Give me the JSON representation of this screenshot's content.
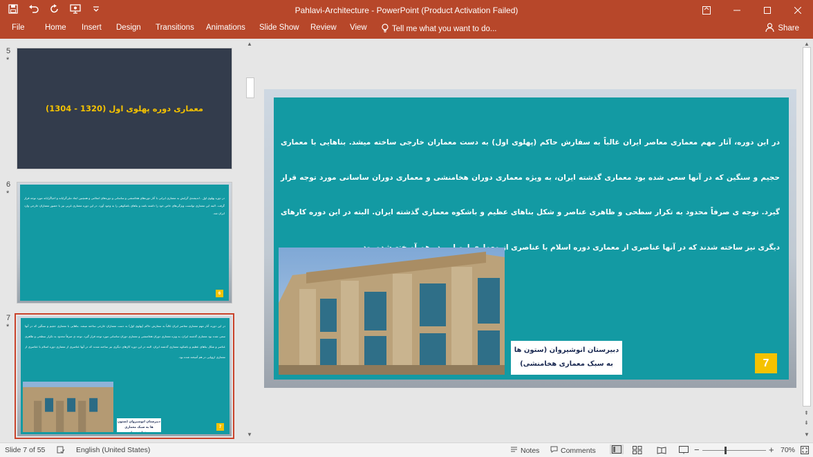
{
  "window": {
    "title": "Pahlavi-Architecture - PowerPoint (Product Activation Failed)",
    "controls": [
      "restore-ribbon",
      "minimize",
      "maximize",
      "close"
    ]
  },
  "quick_access": [
    "save-icon",
    "undo-icon",
    "redo-icon",
    "present-icon",
    "customize-icon"
  ],
  "ribbon": {
    "tabs": [
      "File",
      "Home",
      "Insert",
      "Design",
      "Transitions",
      "Animations",
      "Slide Show",
      "Review",
      "View"
    ],
    "tell_me": "Tell me what you want to do...",
    "share": "Share"
  },
  "thumbnails": [
    {
      "number": "5",
      "star": "*",
      "title": "معماری دوره پهلوی اول (1320 - 1304)"
    },
    {
      "number": "6",
      "star": "*",
      "text": "در دوره پهلوی اول ، انديشه‌ی گرايش به معماری ايرانی با آثار دوره‌های هخامنشی و ساسانی و دوره‌های اسلامی و همچنين ابعاد ملی‌گرايانه و احياگرايانه مورد توجه قرار گرفت. البته اين معماری توانست ويژگی‌های خاص خود را داشته باشد و بناهای باشكوهی را به وجود آورد. در اين دوره معماری غربی نيز با حضور معماران خارجی وارد ايران شد.",
      "badge": "6"
    },
    {
      "number": "7",
      "star": "*",
      "text": "در اين دوره، آثار مهم معماری معاصر ايران غالباً به سفارش حاكم (پهلوی اول) به دست معماران خارجی ساخته ميشد. بناهايی با معماری حجيم و سنگين كه در آنها سعی شده بود معماری گذشته ايران، به ويژه معماری دوران هخامنشی و معماری دوران ساسانی مورد توجه قرار گيرد. توجه ی صرفاً محدود به تكرار سطحی و ظاهری عناصر و شكل بناهای عظيم و باشكوه معماری گذشته ايران. البته در اين دوره كارهای ديگری نيز ساخته شدند كه در آنها عناصری از معماری دوره اسلام با عناصری از معماری اروپايی در هم آميخته شده بود.",
      "caption": "دبيرستان انوشيروان (ستون ها به سبک معماری هخامنشی)",
      "badge": "7"
    }
  ],
  "main_slide": {
    "text": "در این دوره، آثار مهم معماری معاصر ایران غالباً به سفارش حاکم (پهلوی اول) به دست معماران خارجی ساخته میشد. بناهایی با معماری حجیم و سنگین که در آنها سعی شده بود معماری گذشته ایران، به ویژه معماری دوران هخامنشی و معماری دوران ساسانی مورد توجه قرار گیرد. توجه ی صرفاً محدود به تکرار سطحی و ظاهری عناصر و شکل بناهای عظیم و باشکوه معماری گذشته ایران. البته در این دوره کارهای دیگری نیز ساخته شدند که در آنها عناصری از معماری دوره اسلام با عناصری از معماری اروپایی در هم آمیخته شده بود.",
    "caption": "دبیرستان انوشیروان (ستون ها به سبک معماری هخامنشی)",
    "badge": "7"
  },
  "status": {
    "slide": "Slide 7 of 55",
    "language": "English (United States)",
    "notes": "Notes",
    "comments": "Comments",
    "zoom": "70%"
  },
  "colors": {
    "accent": "#b7472a",
    "teal": "#139aa3",
    "badge": "#f5c200",
    "dark_slide": "#333c4c"
  }
}
